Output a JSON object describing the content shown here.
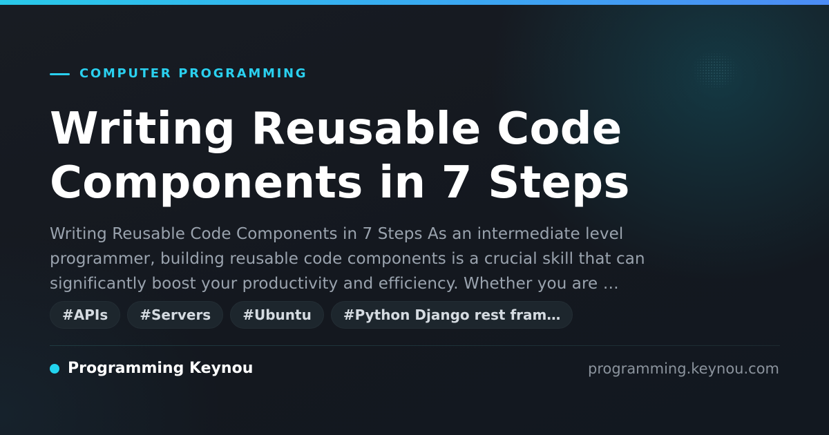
{
  "category": "COMPUTER PROGRAMMING",
  "title": {
    "line1": "Writing Reusable Code",
    "line2": "Components in 7 Steps"
  },
  "description": {
    "line1": "Writing Reusable Code Components in 7 Steps As an intermediate level",
    "line2": "programmer, building reusable code components is a crucial skill that can",
    "line3": "significantly boost your productivity and efficiency. Whether you are …"
  },
  "tags": [
    "#APIs",
    "#Servers",
    "#Ubuntu",
    "#Python Django rest fram…"
  ],
  "footer": {
    "brand": "Programming Keynou",
    "domain": "programming.keynou.com"
  },
  "colors": {
    "accent": "#22d3ee",
    "background": "#151920",
    "title": "#ffffff",
    "description": "#9aa3ae"
  }
}
